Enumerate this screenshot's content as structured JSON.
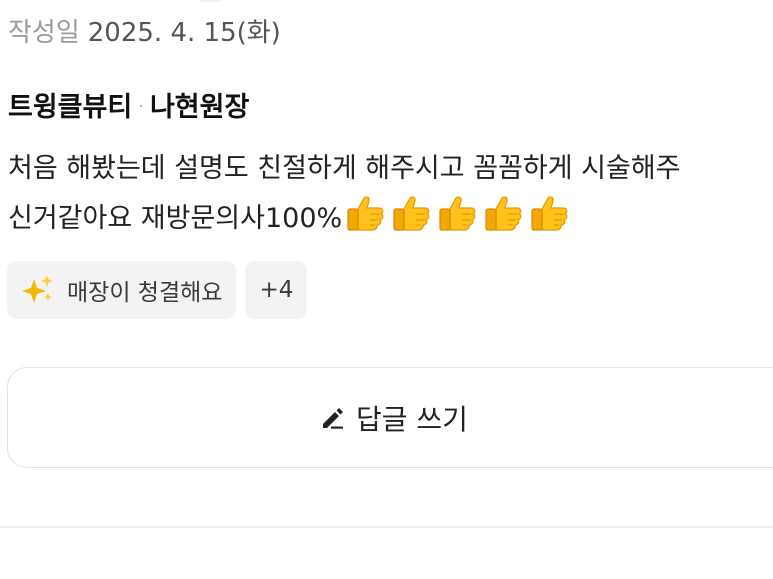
{
  "review": {
    "date_label": "작성일",
    "date_value": "2025. 4. 15(화)",
    "shop_name": "트윙클뷰티",
    "separator": "·",
    "staff_name": "나현원장",
    "text_line1": "처음 해봤는데 설명도 친절하게 해주시고 꼼꼼하게 시술해주",
    "text_line2": "신거같아요 재방문의사100%",
    "thumbs_count": 5
  },
  "tags": {
    "first_label": "매장이 청결해요",
    "first_icon": "sparkles-icon",
    "more_label": "+4"
  },
  "reply_button": {
    "label": "답글 쓰기",
    "icon": "pencil-icon"
  }
}
